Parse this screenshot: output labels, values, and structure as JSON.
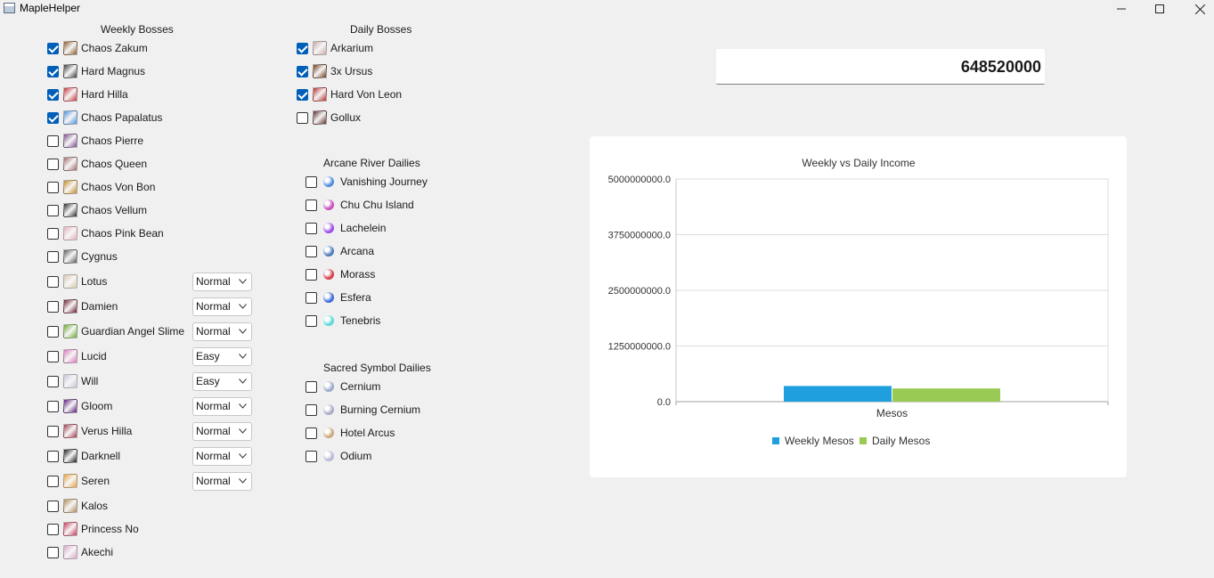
{
  "window": {
    "title": "MapleHelper"
  },
  "weekly": {
    "title": "Weekly Bosses",
    "items": [
      {
        "label": "Chaos Zakum",
        "checked": true,
        "color": "#8a5a2b"
      },
      {
        "label": "Hard Magnus",
        "checked": true,
        "color": "#3a3a3a"
      },
      {
        "label": "Hard Hilla",
        "checked": true,
        "color": "#c8323c"
      },
      {
        "label": "Chaos Papalatus",
        "checked": true,
        "color": "#4a90d9"
      },
      {
        "label": "Chaos Pierre",
        "checked": false,
        "color": "#7a4a8a"
      },
      {
        "label": "Chaos Queen",
        "checked": false,
        "color": "#a06a6a"
      },
      {
        "label": "Chaos Von Bon",
        "checked": false,
        "color": "#c08a2a"
      },
      {
        "label": "Chaos Vellum",
        "checked": false,
        "color": "#2a2a2a"
      },
      {
        "label": "Chaos Pink Bean",
        "checked": false,
        "color": "#e8b0b8"
      },
      {
        "label": "Cygnus",
        "checked": false,
        "color": "#5a5a5a"
      },
      {
        "label": "Lotus",
        "checked": false,
        "color": "#d8c8b0",
        "difficulty": "Normal"
      },
      {
        "label": "Damien",
        "checked": false,
        "color": "#6a1a2a",
        "difficulty": "Normal"
      },
      {
        "label": "Guardian Angel Slime",
        "checked": false,
        "color": "#6aa830",
        "difficulty": "Normal"
      },
      {
        "label": "Lucid",
        "checked": false,
        "color": "#d878b8",
        "difficulty": "Easy"
      },
      {
        "label": "Will",
        "checked": false,
        "color": "#c8c8d8",
        "difficulty": "Easy"
      },
      {
        "label": "Gloom",
        "checked": false,
        "color": "#5a1a7a",
        "difficulty": "Normal"
      },
      {
        "label": "Verus Hilla",
        "checked": false,
        "color": "#a03a4a",
        "difficulty": "Normal"
      },
      {
        "label": "Darknell",
        "checked": false,
        "color": "#1a1a1a",
        "difficulty": "Normal"
      },
      {
        "label": "Seren",
        "checked": false,
        "color": "#e8a040",
        "difficulty": "Normal"
      },
      {
        "label": "Kalos",
        "checked": false,
        "color": "#b08a5a"
      },
      {
        "label": "Princess No",
        "checked": false,
        "color": "#c83a5a"
      },
      {
        "label": "Akechi",
        "checked": false,
        "color": "#d8a8c8"
      }
    ]
  },
  "daily": {
    "title": "Daily Bosses",
    "items": [
      {
        "label": "Arkarium",
        "checked": true,
        "color": "#c8a8a8"
      },
      {
        "label": "3x Ursus",
        "checked": true,
        "color": "#6a3a1a"
      },
      {
        "label": "Hard Von Leon",
        "checked": true,
        "color": "#b82a2a"
      },
      {
        "label": "Gollux",
        "checked": false,
        "color": "#5a2a2a"
      }
    ]
  },
  "arcane": {
    "title": "Arcane River Dailies",
    "items": [
      {
        "label": "Vanishing Journey",
        "checked": false,
        "color": "#4a8ad8"
      },
      {
        "label": "Chu Chu Island",
        "checked": false,
        "color": "#c84ab8"
      },
      {
        "label": "Lachelein",
        "checked": false,
        "color": "#9a4ae8"
      },
      {
        "label": "Arcana",
        "checked": false,
        "color": "#4a7ab8"
      },
      {
        "label": "Morass",
        "checked": false,
        "color": "#d83a4a"
      },
      {
        "label": "Esfera",
        "checked": false,
        "color": "#3a6ad8"
      },
      {
        "label": "Tenebris",
        "checked": false,
        "color": "#5ad8d8"
      }
    ]
  },
  "sacred": {
    "title": "Sacred Symbol Dailies",
    "items": [
      {
        "label": "Cernium",
        "checked": false,
        "color": "#9aa8c8"
      },
      {
        "label": "Burning Cernium",
        "checked": false,
        "color": "#a8a8c8"
      },
      {
        "label": "Hotel Arcus",
        "checked": false,
        "color": "#c8a878"
      },
      {
        "label": "Odium",
        "checked": false,
        "color": "#b8b8d8"
      }
    ]
  },
  "total": {
    "value": "648520000"
  },
  "colors": {
    "weekly": "#209fdf",
    "daily": "#99ca53",
    "accent": "#005fb8"
  },
  "chart_data": {
    "type": "bar",
    "title": "Weekly vs Daily Income",
    "categories": [
      "Mesos"
    ],
    "series": [
      {
        "name": "Weekly Mesos",
        "values": [
          352000000
        ]
      },
      {
        "name": "Daily Mesos",
        "values": [
          296520000
        ]
      }
    ],
    "ylim": [
      0,
      5000000000
    ],
    "yticks": [
      "5000000000.0",
      "3750000000.0",
      "2500000000.0",
      "1250000000.0",
      "0.0"
    ],
    "legend": "bottom",
    "grid": true
  }
}
